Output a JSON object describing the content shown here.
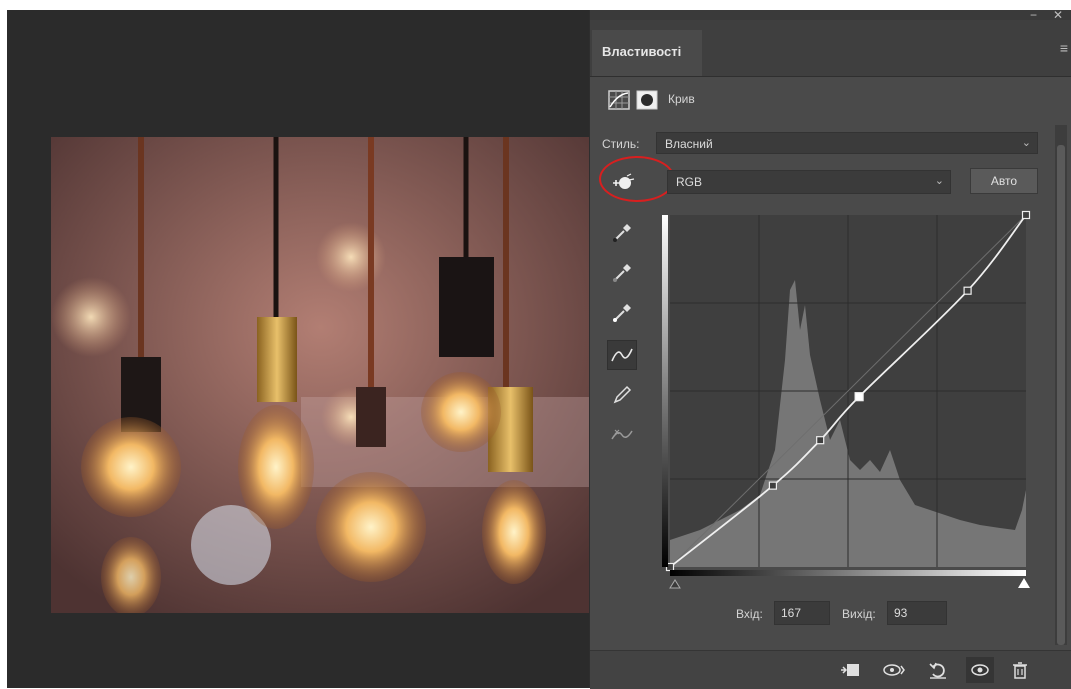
{
  "panel": {
    "tab_label": "Властивості",
    "adjustment_label": "Крив",
    "preset_label": "Стиль:",
    "preset_value": "Власний",
    "channel_value": "RGB",
    "auto_label": "Авто",
    "input_label": "Вхід:",
    "input_value": "167",
    "output_label": "Вихід:",
    "output_value": "93"
  },
  "curve": {
    "points": [
      [
        0,
        0
      ],
      [
        37,
        43
      ],
      [
        54,
        67
      ],
      [
        68,
        90
      ],
      [
        107,
        146
      ],
      [
        128,
        186
      ]
    ],
    "grid_divisions": 4,
    "domain": [
      0,
      128
    ],
    "selected_point_index": 3
  },
  "icons": {
    "tools": [
      "target-adjust-icon",
      "black-point-eyedropper-icon",
      "gray-point-eyedropper-icon",
      "white-point-eyedropper-icon",
      "curve-edit-points-icon",
      "pencil-icon",
      "smooth-curve-icon"
    ],
    "bottom": [
      "clip-to-layer-icon",
      "view-previous-icon",
      "reset-icon",
      "visibility-icon",
      "trash-icon"
    ]
  },
  "colors": {
    "panel_bg": "#4a4a4a",
    "workspace_bg": "#2b2b2b",
    "highlight": "#d81f1f",
    "curve": "#efefef"
  }
}
